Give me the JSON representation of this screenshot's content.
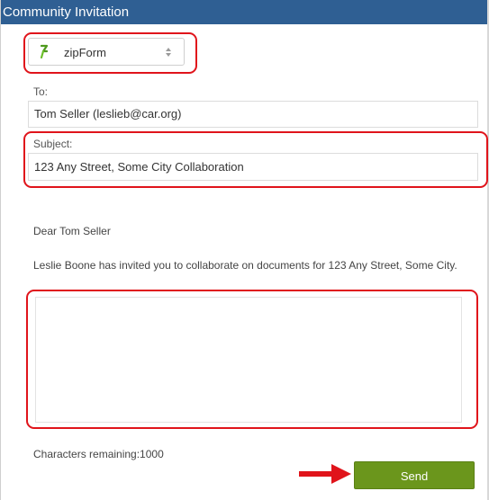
{
  "dialog": {
    "title": "Community Invitation"
  },
  "app_select": {
    "selected": "zipForm",
    "icon": "zipform-icon"
  },
  "to": {
    "label": "To:",
    "value": "Tom Seller (leslieb@car.org)"
  },
  "subject": {
    "label": "Subject:",
    "value": "123 Any Street, Some City Collaboration"
  },
  "body": {
    "greeting": "Dear Tom Seller",
    "invite_text": "Leslie Boone has invited you to collaborate on documents for 123 Any Street, Some City.",
    "message_placeholder": ""
  },
  "counter": {
    "text": "Characters remaining:1000"
  },
  "actions": {
    "send_label": "Send"
  },
  "colors": {
    "titlebar": "#2f5f93",
    "send_button": "#6b961c",
    "highlight": "#e0141b",
    "arrow": "#e0141b"
  }
}
